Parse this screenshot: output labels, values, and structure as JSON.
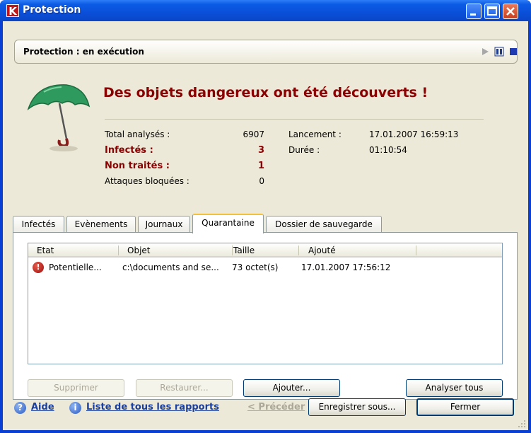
{
  "window": {
    "title": "Protection",
    "logo_letter": "K"
  },
  "status": {
    "text": "Protection : en exécution"
  },
  "headline": "Des objets dangereux ont été découverts !",
  "stats": {
    "total_label": "Total analysés :",
    "total_value": "6907",
    "infected_label": "Infectés :",
    "infected_value": "3",
    "untreated_label": "Non traités :",
    "untreated_value": "1",
    "blocked_label": "Attaques bloquées :",
    "blocked_value": "0",
    "launch_label": "Lancement :",
    "launch_value": "17.01.2007 16:59:13",
    "duration_label": "Durée :",
    "duration_value": "01:10:54"
  },
  "tabs": [
    "Infectés",
    "Evènements",
    "Journaux",
    "Quarantaine",
    "Dossier de sauvegarde"
  ],
  "active_tab": "Quarantaine",
  "list": {
    "columns": [
      "Etat",
      "Objet",
      "Taille",
      "Ajouté"
    ],
    "rows": [
      {
        "etat": "Potentielle...",
        "objet": "c:\\documents and se...",
        "taille": "73 octet(s)",
        "ajoute": "17.01.2007 17:56:12"
      }
    ]
  },
  "buttons": {
    "supprimer": "Supprimer",
    "restaurer": "Restaurer...",
    "ajouter": "Ajouter...",
    "analyser": "Analyser tous",
    "enregistrer": "Enregistrer sous...",
    "fermer": "Fermer"
  },
  "footer": {
    "aide": "Aide",
    "rapports": "Liste de tous les rapports",
    "precedent": "< Précéder"
  },
  "colors": {
    "title_blue": "#0a4fd8",
    "danger_red": "#8b0000",
    "link_blue": "#1a3f9e",
    "umbrella_green": "#2e9a5e"
  }
}
